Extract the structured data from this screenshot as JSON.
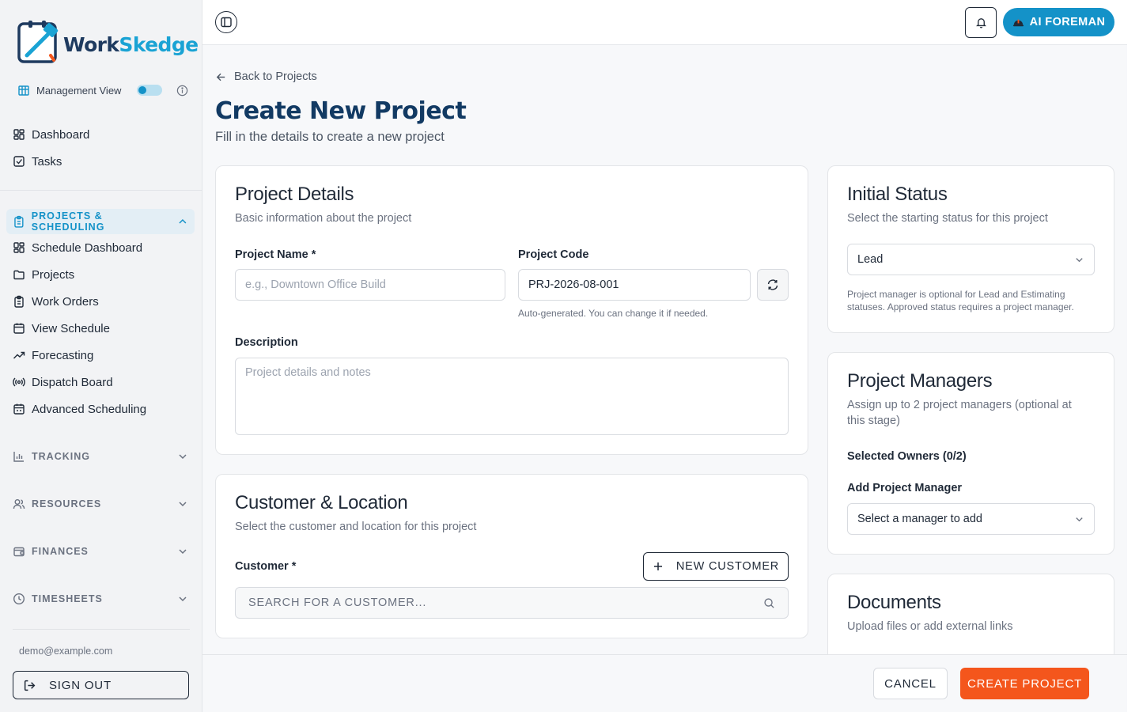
{
  "brand": {
    "name_part1": "Work",
    "name_part2": "Skedge",
    "accent": "#1492c8",
    "navy": "#123a63",
    "orange": "#f4561c"
  },
  "sidebar": {
    "management_view_label": "Management View",
    "management_view_enabled": true,
    "top_items": [
      {
        "label": "Dashboard",
        "icon": "dashboard-icon"
      },
      {
        "label": "Tasks",
        "icon": "checkbox-icon"
      }
    ],
    "projects_section": {
      "label": "PROJECTS & SCHEDULING",
      "expanded": true,
      "items": [
        {
          "label": "Schedule Dashboard",
          "icon": "dashboard-icon"
        },
        {
          "label": "Projects",
          "icon": "folder-icon"
        },
        {
          "label": "Work Orders",
          "icon": "clipboard-icon"
        },
        {
          "label": "View Schedule",
          "icon": "calendar-icon"
        },
        {
          "label": "Forecasting",
          "icon": "trending-up-icon"
        },
        {
          "label": "Dispatch Board",
          "icon": "radio-icon"
        },
        {
          "label": "Advanced Scheduling",
          "icon": "calendar-range-icon"
        }
      ]
    },
    "collapsed_sections": [
      {
        "label": "TRACKING",
        "icon": "bar-chart-icon"
      },
      {
        "label": "RESOURCES",
        "icon": "users-icon"
      },
      {
        "label": "FINANCES",
        "icon": "wallet-icon"
      },
      {
        "label": "TIMESHEETS",
        "icon": "clock-icon"
      }
    ],
    "user_email": "demo@example.com",
    "sign_out_label": "SIGN OUT"
  },
  "topbar": {
    "ai_button_label": "AI FOREMAN"
  },
  "main": {
    "back_label": "Back to Projects",
    "title": "Create New Project",
    "subtitle": "Fill in the details to create a new project"
  },
  "project_details": {
    "title": "Project Details",
    "subtitle": "Basic information about the project",
    "name_label": "Project Name *",
    "name_placeholder": "e.g., Downtown Office Build",
    "code_label": "Project Code",
    "code_value": "PRJ-2026-08-001",
    "code_hint": "Auto-generated. You can change it if needed.",
    "description_label": "Description",
    "description_placeholder": "Project details and notes"
  },
  "customer_location": {
    "title": "Customer & Location",
    "subtitle": "Select the customer and location for this project",
    "customer_label": "Customer *",
    "new_customer_label": "NEW CUSTOMER",
    "search_placeholder": "SEARCH FOR A CUSTOMER..."
  },
  "initial_status": {
    "title": "Initial Status",
    "subtitle": "Select the starting status for this project",
    "selected": "Lead",
    "note": "Project manager is optional for Lead and Estimating statuses. Approved status requires a project manager."
  },
  "project_managers": {
    "title": "Project Managers",
    "subtitle": "Assign up to 2 project managers (optional at this stage)",
    "selected_owners_label": "Selected Owners (0/2)",
    "add_label": "Add Project Manager",
    "select_placeholder": "Select a manager to add"
  },
  "documents": {
    "title": "Documents",
    "subtitle": "Upload files or add external links"
  },
  "footer": {
    "cancel_label": "CANCEL",
    "create_label": "CREATE PROJECT"
  }
}
